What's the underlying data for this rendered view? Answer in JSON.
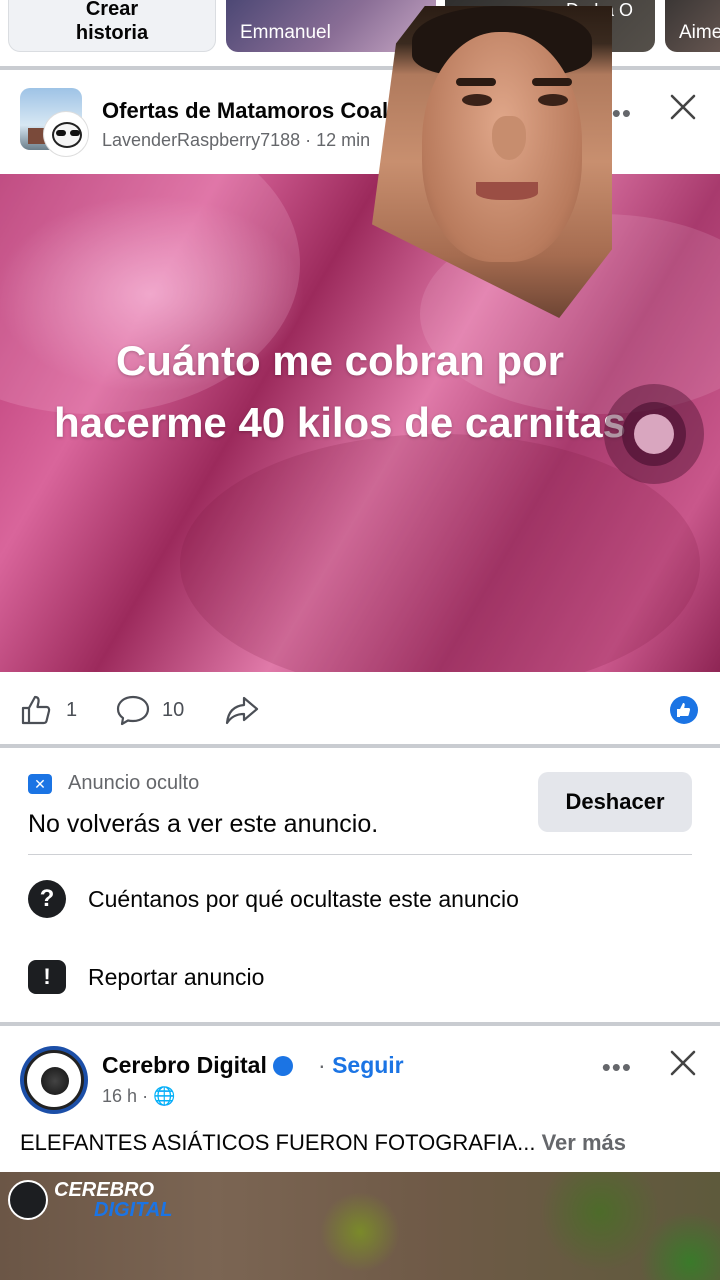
{
  "stories": [
    {
      "label": "Crear historia",
      "type": "create"
    },
    {
      "label": "Emmanuel"
    },
    {
      "label": "Co",
      "top_label": "De La O"
    },
    {
      "label": "Aime"
    }
  ],
  "post1": {
    "group_name": "Ofertas de Matamoros Coal",
    "author": "LavenderRaspberry7188",
    "time": "12 min",
    "caption": "Cuánto me cobran por hacerme 40 kilos de carnitas",
    "likes": "1",
    "comments": "10"
  },
  "hidden_ad": {
    "badge_label": "Anuncio oculto",
    "message": "No volverás a ver este anuncio.",
    "undo_label": "Deshacer",
    "options": [
      {
        "label": "Cuéntanos por qué ocultaste este anuncio",
        "icon": "question-icon"
      },
      {
        "label": "Reportar anuncio",
        "icon": "report-icon"
      }
    ]
  },
  "post2": {
    "page_name": "Cerebro Digital",
    "follow_label": "Seguir",
    "time": "16 h",
    "text": "ELEFANTES ASIÁTICOS FUERON FOTOGRAFIA...",
    "see_more": "Ver más",
    "watermark_line1": "CEREBRO",
    "watermark_line2": "DIGITAL"
  },
  "colors": {
    "accent": "#1b74e4",
    "separator": "#c9ccd1",
    "secondary_text": "#65676b"
  }
}
